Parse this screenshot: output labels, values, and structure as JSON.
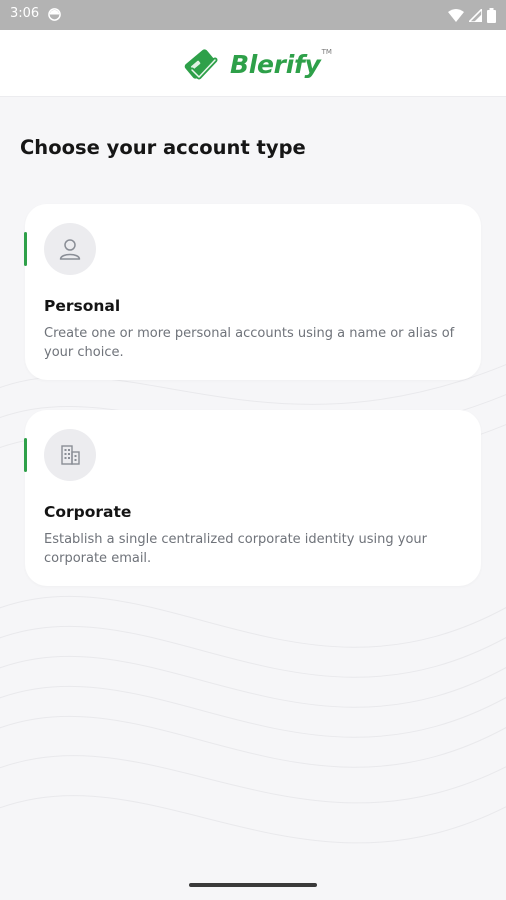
{
  "status_bar": {
    "time": "3:06",
    "icons": [
      "notification-dot-icon",
      "wifi-icon",
      "signal-icon",
      "battery-icon"
    ]
  },
  "header": {
    "app_name": "Blerify",
    "trademark": "TM",
    "brand_color": "#2ea049"
  },
  "main": {
    "title": "Choose your account type",
    "options": [
      {
        "title": "Personal",
        "description": "Create one or more personal accounts using a name or alias of your choice.",
        "icon": "person-icon"
      },
      {
        "title": "Corporate",
        "description": "Establish a single centralized corporate identity using your corporate email.",
        "icon": "building-icon"
      }
    ]
  },
  "colors": {
    "accent": "#2ea049",
    "background": "#f6f6f8",
    "card": "#ffffff",
    "status_bar": "#b3b3b3",
    "secondary_text": "#6f737a"
  }
}
